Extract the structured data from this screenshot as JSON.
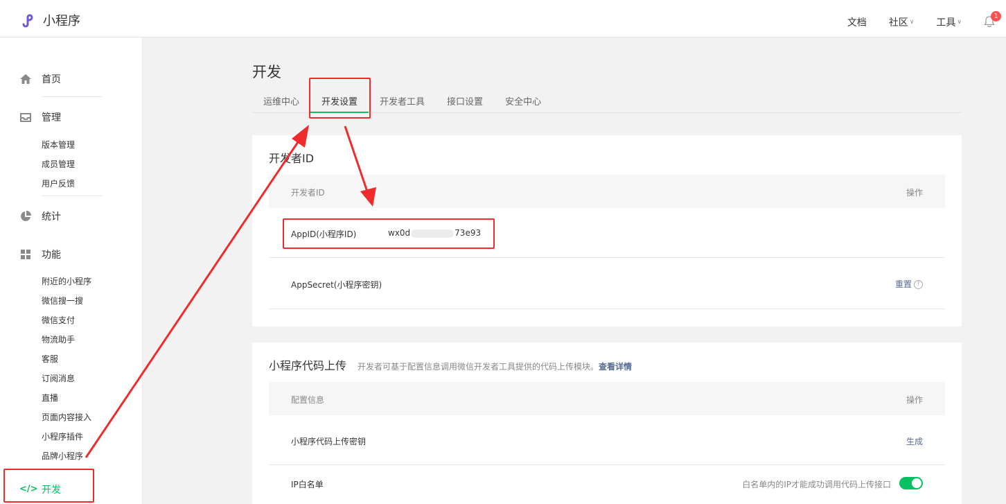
{
  "header": {
    "app_name": "小程序",
    "nav": {
      "docs": "文档",
      "community": "社区",
      "tools": "工具"
    },
    "notification_count": "1"
  },
  "sidebar": {
    "home": "首页",
    "manage": {
      "label": "管理",
      "items": [
        "版本管理",
        "成员管理",
        "用户反馈"
      ]
    },
    "stats": "统计",
    "features": {
      "label": "功能",
      "items": [
        "附近的小程序",
        "微信搜一搜",
        "微信支付",
        "物流助手",
        "客服",
        "订阅消息",
        "直播",
        "页面内容接入",
        "小程序插件",
        "品牌小程序"
      ]
    },
    "dev": "开发"
  },
  "page": {
    "title": "开发",
    "tabs": [
      "运维中心",
      "开发设置",
      "开发者工具",
      "接口设置",
      "安全中心"
    ],
    "active_tab": "开发设置"
  },
  "dev_id": {
    "title": "开发者ID",
    "col_left": "开发者ID",
    "col_right": "操作",
    "appid_label": "AppID(小程序ID)",
    "appid_prefix": "wx0d",
    "appid_suffix": "73e93",
    "secret_label": "AppSecret(小程序密钥)",
    "secret_action": "重置"
  },
  "upload": {
    "title": "小程序代码上传",
    "desc": "开发者可基于配置信息调用微信开发者工具提供的代码上传模块。",
    "desc_link": "查看详情",
    "col_left": "配置信息",
    "col_right": "操作",
    "key_label": "小程序代码上传密钥",
    "key_action": "生成",
    "ip_label": "IP白名单",
    "ip_hint": "白名单内的IP才能成功调用代码上传接口"
  },
  "colors": {
    "accent": "#07c160",
    "link": "#576b95",
    "annotation": "#ef2b2b"
  }
}
